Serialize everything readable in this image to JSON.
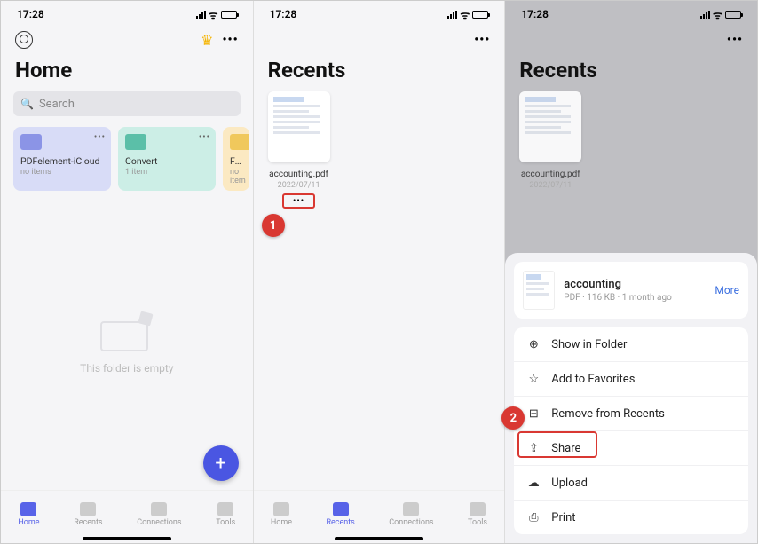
{
  "status": {
    "time": "17:28"
  },
  "phone1": {
    "title": "Home",
    "search_placeholder": "Search",
    "folders": [
      {
        "name": "PDFelement-iCloud",
        "sub": "no items"
      },
      {
        "name": "Convert",
        "sub": "1 item"
      },
      {
        "name": "Favori",
        "sub": "no item"
      }
    ],
    "empty_text": "This folder is empty",
    "fab": "+"
  },
  "phone2": {
    "title": "Recents",
    "file": {
      "name": "accounting.pdf",
      "date": "2022/07/11",
      "more": "•••"
    }
  },
  "phone3": {
    "title": "Recents",
    "file": {
      "name": "accounting.pdf",
      "date": "2022/07/11"
    },
    "sheet": {
      "file_name": "accounting",
      "file_meta": "PDF · 116 KB · 1 month ago",
      "more": "More",
      "actions": {
        "show_in_folder": "Show in Folder",
        "add_favorites": "Add to Favorites",
        "remove_recents": "Remove from Recents",
        "share": "Share",
        "upload": "Upload",
        "print": "Print"
      }
    }
  },
  "tabs": {
    "home": "Home",
    "recents": "Recents",
    "connections": "Connections",
    "tools": "Tools"
  },
  "callouts": {
    "one": "1",
    "two": "2"
  }
}
